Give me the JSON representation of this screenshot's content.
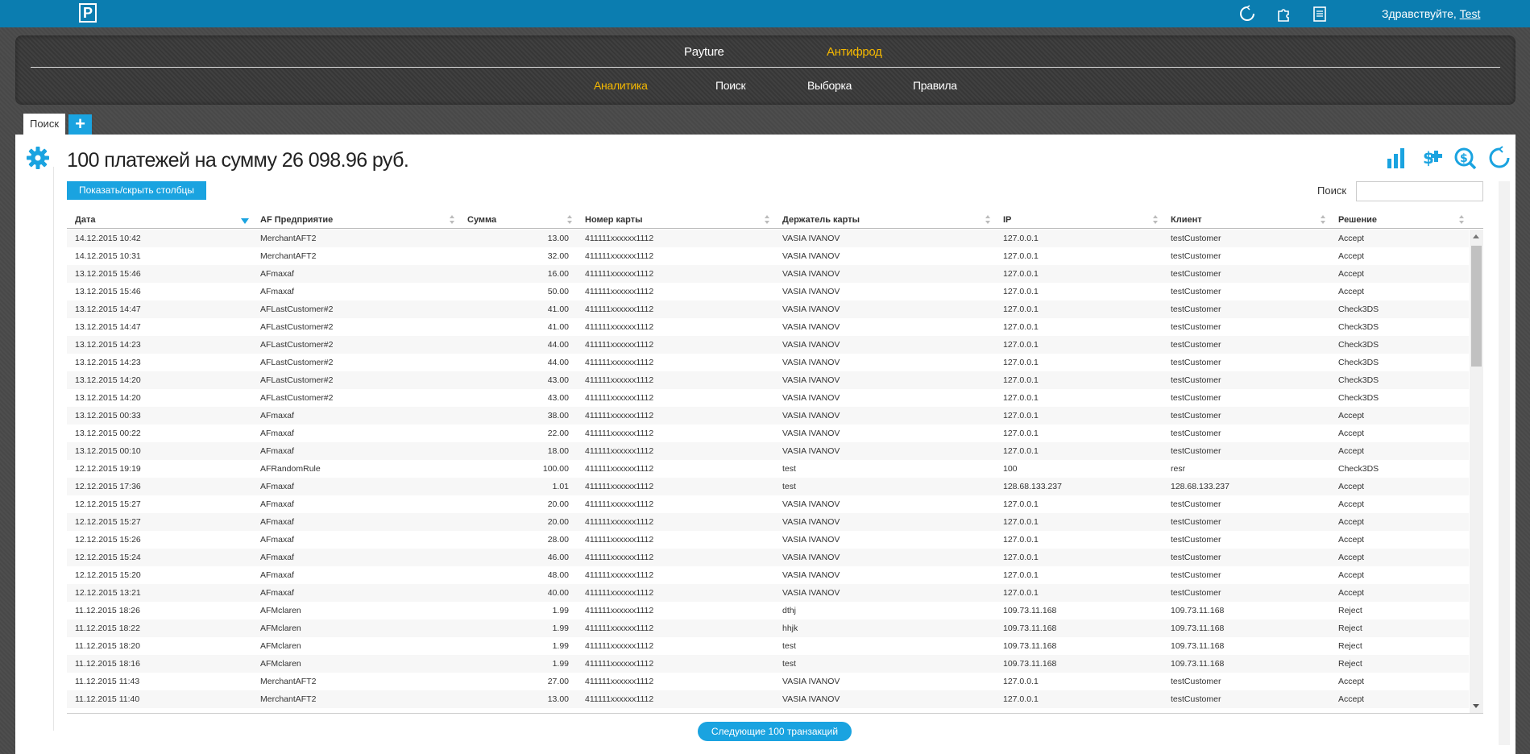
{
  "app": {
    "logo_letter": "P",
    "greeting": "Здравствуйте,",
    "user": "Test"
  },
  "nav": {
    "top": [
      {
        "label": "Payture",
        "active": false
      },
      {
        "label": "Антифрод",
        "active": true
      }
    ],
    "sub": [
      {
        "label": "Аналитика",
        "active": true
      },
      {
        "label": "Поиск",
        "active": false
      },
      {
        "label": "Выборка",
        "active": false
      },
      {
        "label": "Правила",
        "active": false
      }
    ]
  },
  "tabs": [
    {
      "label": "Поиск"
    }
  ],
  "tab_add_label": "+",
  "main": {
    "title": "100 платежей на сумму 26 098.96 руб.",
    "toggle_columns_label": "Показать/скрыть столбцы",
    "search_label": "Поиск",
    "search_value": "",
    "next_button_label": "Следующие 100 транзакций"
  },
  "table": {
    "columns": [
      "Дата",
      "AF Предприятие",
      "Сумма",
      "Номер карты",
      "Держатель карты",
      "IP",
      "Клиент",
      "Решение"
    ],
    "sorted_column": "Дата",
    "rows": [
      [
        "14.12.2015 10:42",
        "MerchantAFT2",
        "13.00",
        "411111xxxxxx1112",
        "VASIA IVANOV",
        "127.0.0.1",
        "testCustomer",
        "Accept"
      ],
      [
        "14.12.2015 10:31",
        "MerchantAFT2",
        "32.00",
        "411111xxxxxx1112",
        "VASIA IVANOV",
        "127.0.0.1",
        "testCustomer",
        "Accept"
      ],
      [
        "13.12.2015 15:46",
        "AFmaxaf",
        "16.00",
        "411111xxxxxx1112",
        "VASIA IVANOV",
        "127.0.0.1",
        "testCustomer",
        "Accept"
      ],
      [
        "13.12.2015 15:46",
        "AFmaxaf",
        "50.00",
        "411111xxxxxx1112",
        "VASIA IVANOV",
        "127.0.0.1",
        "testCustomer",
        "Accept"
      ],
      [
        "13.12.2015 14:47",
        "AFLastCustomer#2",
        "41.00",
        "411111xxxxxx1112",
        "VASIA IVANOV",
        "127.0.0.1",
        "testCustomer",
        "Check3DS"
      ],
      [
        "13.12.2015 14:47",
        "AFLastCustomer#2",
        "41.00",
        "411111xxxxxx1112",
        "VASIA IVANOV",
        "127.0.0.1",
        "testCustomer",
        "Check3DS"
      ],
      [
        "13.12.2015 14:23",
        "AFLastCustomer#2",
        "44.00",
        "411111xxxxxx1112",
        "VASIA IVANOV",
        "127.0.0.1",
        "testCustomer",
        "Check3DS"
      ],
      [
        "13.12.2015 14:23",
        "AFLastCustomer#2",
        "44.00",
        "411111xxxxxx1112",
        "VASIA IVANOV",
        "127.0.0.1",
        "testCustomer",
        "Check3DS"
      ],
      [
        "13.12.2015 14:20",
        "AFLastCustomer#2",
        "43.00",
        "411111xxxxxx1112",
        "VASIA IVANOV",
        "127.0.0.1",
        "testCustomer",
        "Check3DS"
      ],
      [
        "13.12.2015 14:20",
        "AFLastCustomer#2",
        "43.00",
        "411111xxxxxx1112",
        "VASIA IVANOV",
        "127.0.0.1",
        "testCustomer",
        "Check3DS"
      ],
      [
        "13.12.2015 00:33",
        "AFmaxaf",
        "38.00",
        "411111xxxxxx1112",
        "VASIA IVANOV",
        "127.0.0.1",
        "testCustomer",
        "Accept"
      ],
      [
        "13.12.2015 00:22",
        "AFmaxaf",
        "22.00",
        "411111xxxxxx1112",
        "VASIA IVANOV",
        "127.0.0.1",
        "testCustomer",
        "Accept"
      ],
      [
        "13.12.2015 00:10",
        "AFmaxaf",
        "18.00",
        "411111xxxxxx1112",
        "VASIA IVANOV",
        "127.0.0.1",
        "testCustomer",
        "Accept"
      ],
      [
        "12.12.2015 19:19",
        "AFRandomRule",
        "100.00",
        "411111xxxxxx1112",
        "test",
        "100",
        "resr",
        "Check3DS"
      ],
      [
        "12.12.2015 17:36",
        "AFmaxaf",
        "1.01",
        "411111xxxxxx1112",
        "test",
        "128.68.133.237",
        "128.68.133.237",
        "Accept"
      ],
      [
        "12.12.2015 15:27",
        "AFmaxaf",
        "20.00",
        "411111xxxxxx1112",
        "VASIA IVANOV",
        "127.0.0.1",
        "testCustomer",
        "Accept"
      ],
      [
        "12.12.2015 15:27",
        "AFmaxaf",
        "20.00",
        "411111xxxxxx1112",
        "VASIA IVANOV",
        "127.0.0.1",
        "testCustomer",
        "Accept"
      ],
      [
        "12.12.2015 15:26",
        "AFmaxaf",
        "28.00",
        "411111xxxxxx1112",
        "VASIA IVANOV",
        "127.0.0.1",
        "testCustomer",
        "Accept"
      ],
      [
        "12.12.2015 15:24",
        "AFmaxaf",
        "46.00",
        "411111xxxxxx1112",
        "VASIA IVANOV",
        "127.0.0.1",
        "testCustomer",
        "Accept"
      ],
      [
        "12.12.2015 15:20",
        "AFmaxaf",
        "48.00",
        "411111xxxxxx1112",
        "VASIA IVANOV",
        "127.0.0.1",
        "testCustomer",
        "Accept"
      ],
      [
        "12.12.2015 13:21",
        "AFmaxaf",
        "40.00",
        "411111xxxxxx1112",
        "VASIA IVANOV",
        "127.0.0.1",
        "testCustomer",
        "Accept"
      ],
      [
        "11.12.2015 18:26",
        "AFMclaren",
        "1.99",
        "411111xxxxxx1112",
        "dthj",
        "109.73.11.168",
        "109.73.11.168",
        "Reject"
      ],
      [
        "11.12.2015 18:22",
        "AFMclaren",
        "1.99",
        "411111xxxxxx1112",
        "hhjk",
        "109.73.11.168",
        "109.73.11.168",
        "Reject"
      ],
      [
        "11.12.2015 18:20",
        "AFMclaren",
        "1.99",
        "411111xxxxxx1112",
        "test",
        "109.73.11.168",
        "109.73.11.168",
        "Reject"
      ],
      [
        "11.12.2015 18:16",
        "AFMclaren",
        "1.99",
        "411111xxxxxx1112",
        "test",
        "109.73.11.168",
        "109.73.11.168",
        "Reject"
      ],
      [
        "11.12.2015 11:43",
        "MerchantAFT2",
        "27.00",
        "411111xxxxxx1112",
        "VASIA IVANOV",
        "127.0.0.1",
        "testCustomer",
        "Accept"
      ],
      [
        "11.12.2015 11:40",
        "MerchantAFT2",
        "13.00",
        "411111xxxxxx1112",
        "VASIA IVANOV",
        "127.0.0.1",
        "testCustomer",
        "Accept"
      ]
    ]
  },
  "icons": {
    "top": [
      "refresh-icon",
      "puzzle-icon",
      "clipboard-icon"
    ],
    "toolbar": [
      "bar-chart-icon",
      "money-filter-icon",
      "money-search-icon",
      "refresh-icon"
    ],
    "settings": "gear-icon"
  },
  "colors": {
    "topbar": "#0b7db0",
    "accent": "#1aa3e0",
    "active_nav": "#f5b800"
  }
}
